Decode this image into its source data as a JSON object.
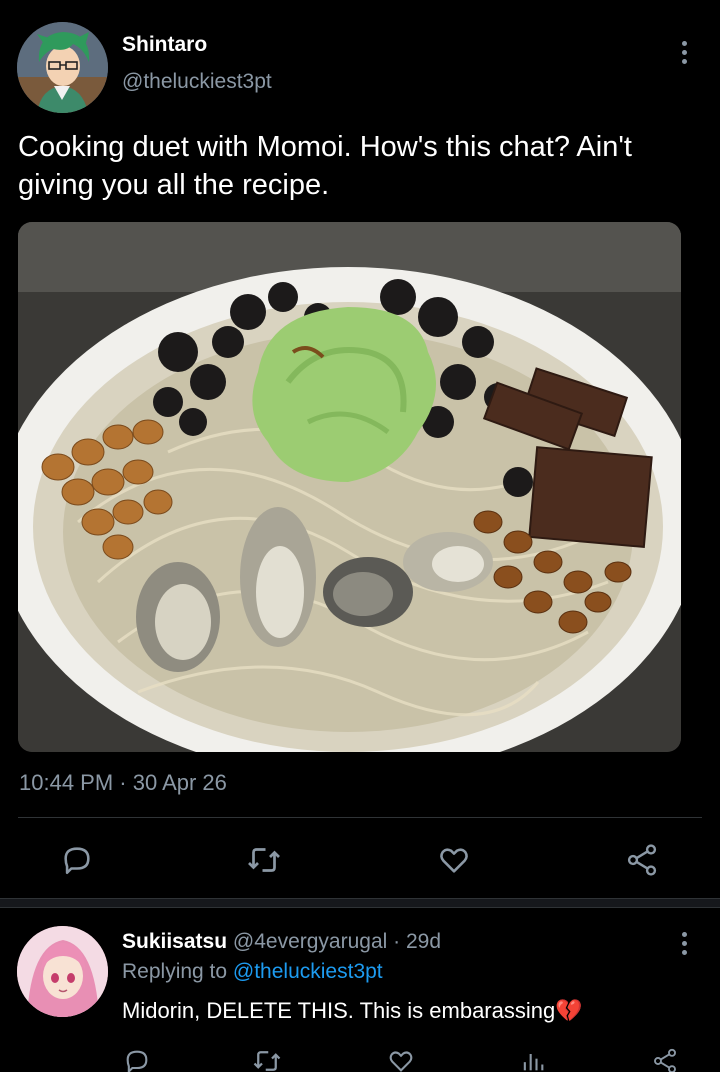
{
  "tweet": {
    "author_name": "Shintaro",
    "author_handle": "@theluckiest3pt",
    "text": "Cooking duet with Momoi. How's this chat? Ain't giving you all the recipe.",
    "timestamp": "10:44 PM · 30 Apr 26",
    "photo_alt": "Plate of pasta with cream sauce, green ice cream, oysters, natto, beans, cookie crumbs and chocolate pieces",
    "actions": [
      "reply-icon",
      "retweet-icon",
      "like-icon",
      "share-icon"
    ]
  },
  "reply": {
    "author_name": "Sukiisatsu",
    "author_handle": "@4evergyarugal",
    "age": "29d",
    "replying_prefix": "Replying to",
    "replying_to": "@theluckiest3pt",
    "text": "Midorin, DELETE THIS. This is embarassing",
    "emoji": "💔",
    "actions": [
      "reply-icon",
      "retweet-icon",
      "like-icon",
      "views-icon",
      "share-icon"
    ]
  },
  "colors": {
    "background": "#000000",
    "text_primary": "#ffffff",
    "text_secondary": "#8b98a5",
    "link": "#1d9bf0",
    "divider": "#2f3336"
  }
}
